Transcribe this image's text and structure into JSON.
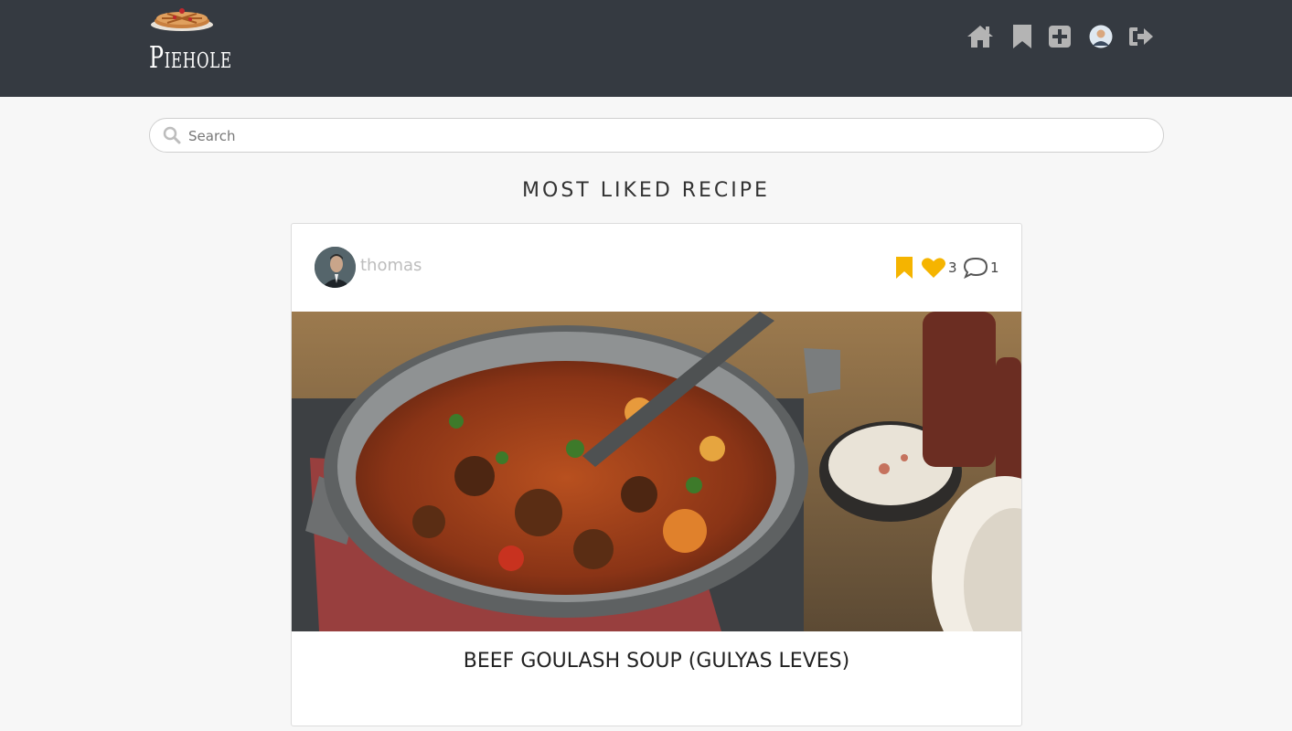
{
  "header": {
    "logo_text": "Piehole",
    "nav": [
      {
        "icon": "home-icon"
      },
      {
        "icon": "bookmark-icon"
      },
      {
        "icon": "plus-square-icon"
      },
      {
        "icon": "user-avatar"
      },
      {
        "icon": "sign-out-icon"
      }
    ]
  },
  "search": {
    "placeholder": "Search",
    "value": ""
  },
  "section": {
    "title": "MOST LIKED RECIPE"
  },
  "recipe": {
    "author": "thomas",
    "likes": "3",
    "comments": "1",
    "title": "BEEF GOULASH SOUP (GULYAS LEVES)",
    "image_alt": "Beef goulash soup in a cast iron pot"
  },
  "colors": {
    "topbar": "#353a41",
    "accent": "#f5b400",
    "nav_icon": "#b4b4b4"
  }
}
